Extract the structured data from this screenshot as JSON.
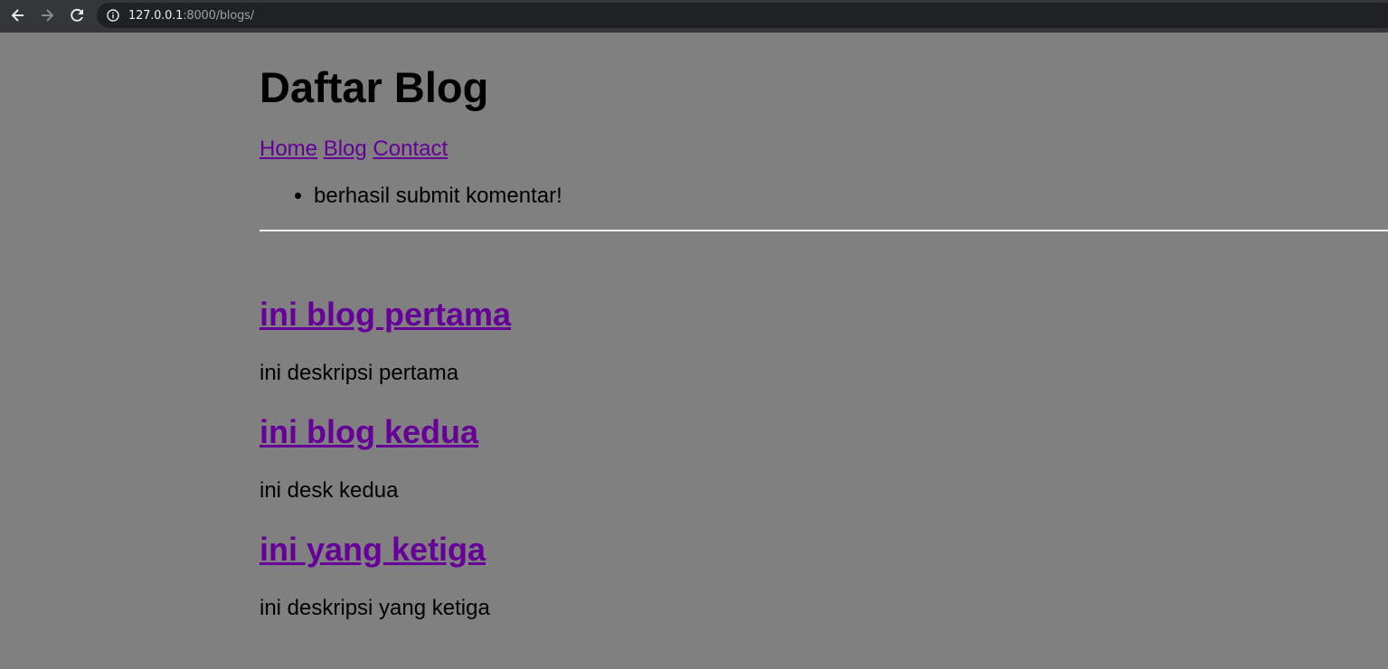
{
  "browser": {
    "url_host": "127.0.0.1",
    "url_path": ":8000/blogs/",
    "icons": {
      "back": "arrow-left-icon",
      "forward": "arrow-right-icon",
      "reload": "reload-icon",
      "info": "info-icon"
    }
  },
  "page": {
    "title": "Daftar Blog",
    "nav": {
      "home": "Home",
      "blog": "Blog",
      "contact": "Contact"
    },
    "messages": [
      "berhasil submit komentar!"
    ],
    "blogs": [
      {
        "title": "ini blog pertama",
        "description": "ini deskripsi pertama"
      },
      {
        "title": "ini blog kedua",
        "description": "ini desk kedua"
      },
      {
        "title": "ini yang ketiga",
        "description": "ini deskripsi yang ketiga"
      }
    ]
  },
  "colors": {
    "page_background": "#808080",
    "link_visited": "#660099",
    "browser_chrome": "#35363a",
    "omnibox": "#202124"
  }
}
